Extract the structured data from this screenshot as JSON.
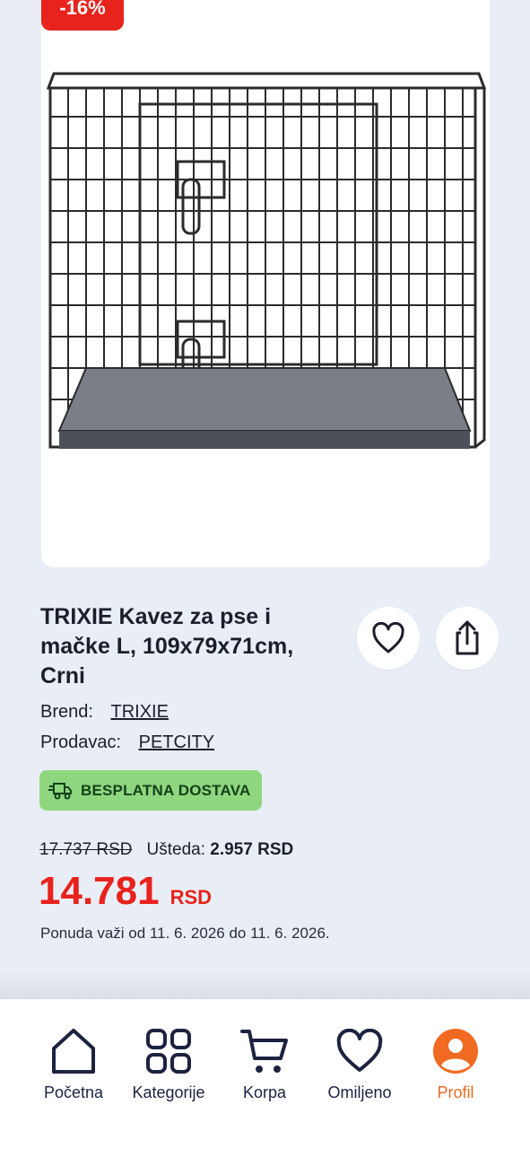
{
  "product": {
    "discount_badge": "-16%",
    "title": "TRIXIE Kavez za pse i mačke L, 109x79x71cm, Crni",
    "brand_label": "Brend:",
    "brand_value": "TRIXIE",
    "seller_label": "Prodavac:",
    "seller_value": "PETCITY",
    "shipping_badge": "BESPLATNA DOSTAVA",
    "old_price": "17.737 RSD",
    "savings_label": "Ušteda:",
    "savings_value": "2.957 RSD",
    "price_amount": "14.781",
    "price_currency": "RSD",
    "offer_note": "Ponuda važi od 11. 6. 2026 do 11. 6. 2026."
  },
  "icons": {
    "favorite": "heart-icon",
    "share": "share-icon",
    "shipping": "truck-icon"
  },
  "nav": {
    "items": [
      {
        "label": "Početna",
        "icon": "home-icon"
      },
      {
        "label": "Kategorije",
        "icon": "grid-icon"
      },
      {
        "label": "Korpa",
        "icon": "cart-icon"
      },
      {
        "label": "Omiljeno",
        "icon": "heart-icon"
      },
      {
        "label": "Profil",
        "icon": "profile-icon",
        "active": true
      }
    ]
  },
  "colors": {
    "accent": "#e8221c",
    "active_nav": "#f06a22",
    "shipping_badge_bg": "#8fd77f",
    "background": "#e9eef6"
  }
}
